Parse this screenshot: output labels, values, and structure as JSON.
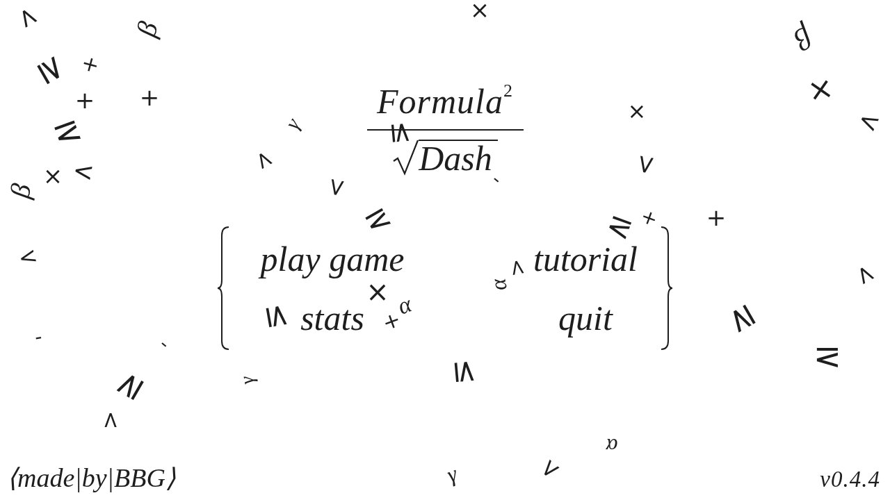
{
  "title": {
    "numerator": "Formula$^{2}$",
    "denominator": "Dash"
  },
  "menu": {
    "items": [
      {
        "label": "play game"
      },
      {
        "label": "tutorial"
      },
      {
        "label": "stats"
      },
      {
        "label": "quit"
      }
    ]
  },
  "credit": "⟨made|by|BBG⟩",
  "version": "v0.4.4",
  "background_symbols": [
    {
      "glyph": "<",
      "kind": "operator"
    },
    {
      "glyph": "×",
      "kind": "operator"
    },
    {
      "glyph": "β",
      "kind": "letter"
    },
    {
      "glyph": "β",
      "kind": "letter"
    },
    {
      "glyph": "+",
      "kind": "operator"
    },
    {
      "glyph": "≥",
      "kind": "operator"
    },
    {
      "glyph": "+",
      "kind": "operator"
    },
    {
      "glyph": "×",
      "kind": "operator"
    },
    {
      "glyph": "+",
      "kind": "operator"
    },
    {
      "glyph": "×",
      "kind": "operator"
    },
    {
      "glyph": "<",
      "kind": "operator"
    },
    {
      "glyph": "γ",
      "kind": "letter"
    },
    {
      "glyph": "≥",
      "kind": "operator"
    },
    {
      "glyph": "≤",
      "kind": "operator"
    },
    {
      "glyph": "<",
      "kind": "operator"
    },
    {
      "glyph": "<",
      "kind": "operator"
    },
    {
      "glyph": "×",
      "kind": "operator"
    },
    {
      "glyph": "<",
      "kind": "operator"
    },
    {
      "glyph": "-",
      "kind": "operator"
    },
    {
      "glyph": "<",
      "kind": "operator"
    },
    {
      "glyph": "β",
      "kind": "letter"
    },
    {
      "glyph": "+",
      "kind": "operator"
    },
    {
      "glyph": "≥",
      "kind": "operator"
    },
    {
      "glyph": "≥",
      "kind": "operator"
    },
    {
      "glyph": "<",
      "kind": "operator"
    },
    {
      "glyph": "+",
      "kind": "operator"
    },
    {
      "glyph": "<",
      "kind": "operator"
    },
    {
      "glyph": "<",
      "kind": "operator"
    },
    {
      "glyph": "α",
      "kind": "letter"
    },
    {
      "glyph": "×",
      "kind": "operator"
    },
    {
      "glyph": "α",
      "kind": "letter"
    },
    {
      "glyph": "≤",
      "kind": "operator"
    },
    {
      "glyph": "+",
      "kind": "operator"
    },
    {
      "glyph": "≥",
      "kind": "operator"
    },
    {
      "glyph": "-",
      "kind": "operator"
    },
    {
      "glyph": "-",
      "kind": "operator"
    },
    {
      "glyph": "≥",
      "kind": "operator"
    },
    {
      "glyph": "≤",
      "kind": "operator"
    },
    {
      "glyph": "γ",
      "kind": "letter"
    },
    {
      "glyph": "≥",
      "kind": "operator"
    },
    {
      "glyph": "<",
      "kind": "operator"
    },
    {
      "glyph": "α",
      "kind": "letter"
    },
    {
      "glyph": "<",
      "kind": "operator"
    },
    {
      "glyph": "γ",
      "kind": "letter"
    }
  ]
}
